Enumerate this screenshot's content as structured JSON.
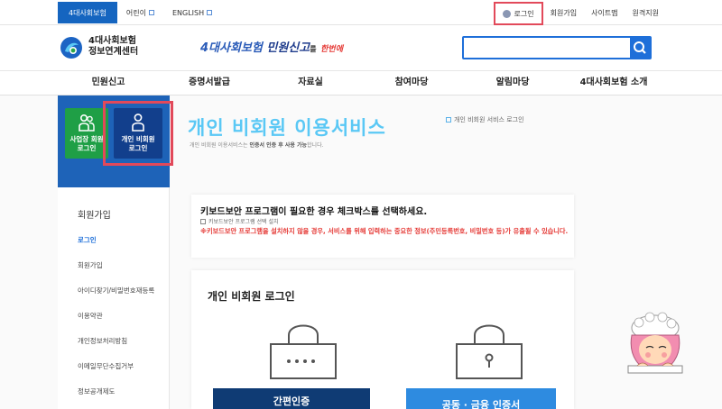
{
  "topbar": {
    "tabs": [
      {
        "label": "4대사회보험"
      },
      {
        "label": "어린이"
      },
      {
        "label": "ENGLISH"
      }
    ],
    "util": {
      "login": "로그인",
      "signup": "회원가입",
      "sitemap": "사이트맵",
      "remote": "원격지원"
    }
  },
  "header": {
    "logo_line1": "4대사회보험",
    "logo_line2": "정보연계센터",
    "slogan_main": "4대사회보험",
    "slogan_bold": "민원신고",
    "slogan_small": "를",
    "slogan_red": "한번에",
    "search_placeholder": ""
  },
  "gnb": [
    "민원신고",
    "증명서발급",
    "자료실",
    "참여마당",
    "알림마당",
    "4대사회보험 소개"
  ],
  "login_box": {
    "biz_line1": "사업장 회원",
    "biz_line2": "로그인",
    "personal_line1": "개인 비회원",
    "personal_line2": "로그인"
  },
  "sidebar": {
    "title": "회원가입",
    "items": [
      {
        "label": "로그인",
        "active": true
      },
      {
        "label": "회원가입"
      },
      {
        "label": "아이디찾기/비밀번호재등록"
      },
      {
        "label": "이용약관"
      },
      {
        "label": "개인정보처리방침"
      },
      {
        "label": "이메일무단수집거부"
      },
      {
        "label": "정보공개제도"
      }
    ]
  },
  "main": {
    "title": "개인 비회원 이용서비스",
    "desc_normal": "개인 비회원 이용서비스는",
    "desc_bold": "인증서 인증 후 사용 가능",
    "desc_end": "합니다.",
    "breadcrumb": "개인 비회원 서비스 로그인",
    "keyboard": {
      "title": "키보드보안 프로그램이 필요한 경우 체크박스를 선택하세요.",
      "checkbox_label": "키보드보안 프로그램 선택 설치",
      "warning": "※키보드보안 프로그램을 설치하지 않을 경우, 서비스를 위해 입력하는 중요한 정보(주민등록번호, 비밀번호 등)가 유출될 수 있습니다."
    },
    "login_section": {
      "title": "개인 비회원 로그인",
      "btn_simple": "간편인증",
      "btn_cert": "공동 · 금융 인증서"
    }
  },
  "colors": {
    "primary": "#1565c0",
    "highlight": "#e2495a",
    "title": "#5ac8f5",
    "warning": "#e53935",
    "green": "#1f9f46"
  }
}
